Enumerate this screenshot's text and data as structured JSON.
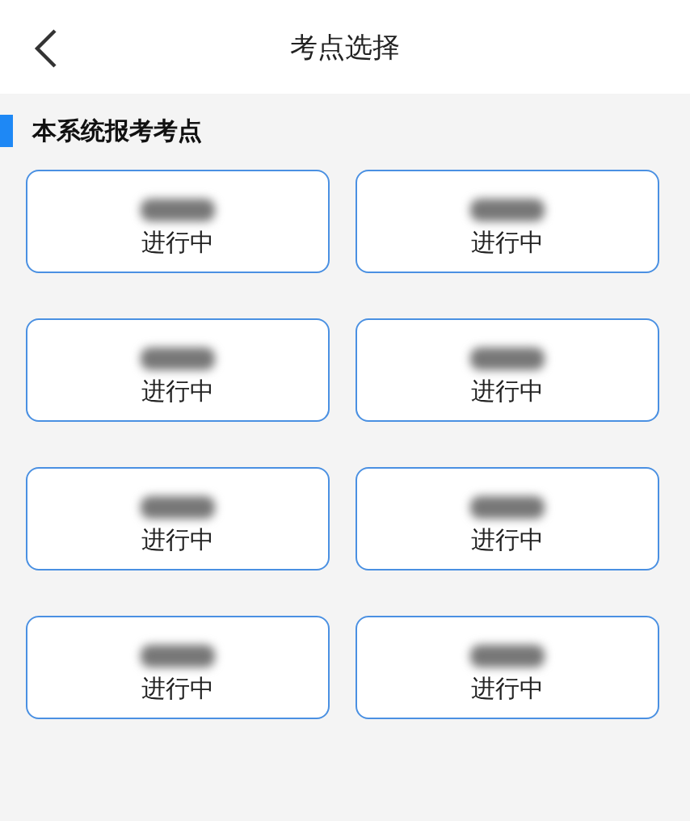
{
  "header": {
    "title": "考点选择"
  },
  "section": {
    "title": "本系统报考考点"
  },
  "exam_sites": [
    {
      "status": "进行中"
    },
    {
      "status": "进行中"
    },
    {
      "status": "进行中"
    },
    {
      "status": "进行中"
    },
    {
      "status": "进行中"
    },
    {
      "status": "进行中"
    },
    {
      "status": "进行中"
    },
    {
      "status": "进行中"
    }
  ]
}
